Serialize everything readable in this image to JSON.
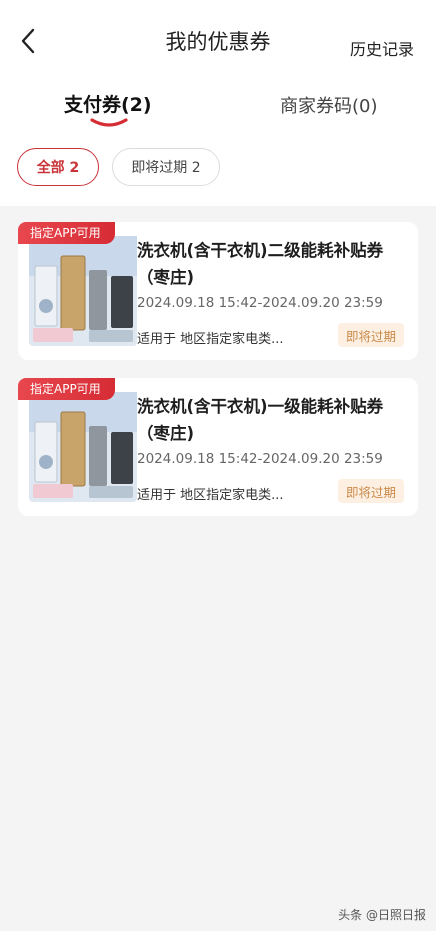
{
  "header": {
    "title": "我的优惠券",
    "history_label": "历史记录"
  },
  "tabs": [
    {
      "label": "支付券(2)",
      "active": true
    },
    {
      "label": "商家券码(0)",
      "active": false
    }
  ],
  "filters": [
    {
      "label": "全部 2",
      "active": true
    },
    {
      "label": "即将过期 2",
      "active": false
    }
  ],
  "coupons": [
    {
      "tag": "指定APP可用",
      "title": "洗衣机(含干衣机)二级能耗补贴券（枣庄)",
      "validity": "2024.09.18 15:42-2024.09.20 23:59",
      "scope": "适用于 地区指定家电类...",
      "status": "即将过期"
    },
    {
      "tag": "指定APP可用",
      "title": "洗衣机(含干衣机)一级能耗补贴券（枣庄)",
      "validity": "2024.09.18 15:42-2024.09.20 23:59",
      "scope": "适用于 地区指定家电类...",
      "status": "即将过期"
    }
  ],
  "watermark": "头条 @日照日报",
  "colors": {
    "accent_red": "#c9343a",
    "tag_red": "#e8474e",
    "badge_bg": "#fdf0e2",
    "badge_text": "#c98a4a",
    "page_bg": "#f4f4f4"
  }
}
